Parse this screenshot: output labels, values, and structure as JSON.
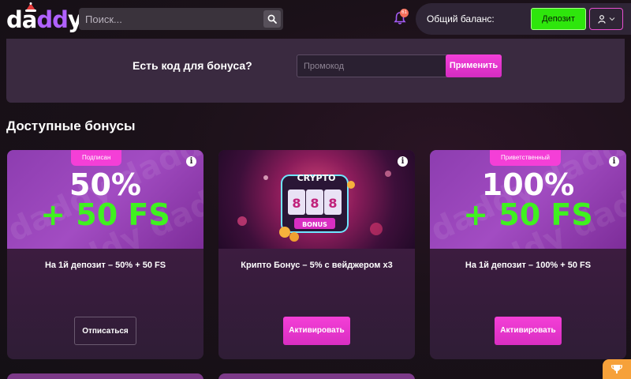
{
  "header": {
    "logo": "daddy",
    "search": {
      "placeholder": "Поиск..."
    },
    "notifications_count": "61",
    "balance_label": "Общий баланс:",
    "deposit_label": "Депозит"
  },
  "bonus_code": {
    "label": "Есть код для бонуса?",
    "placeholder": "Промокод",
    "apply_label": "Применить"
  },
  "section_title": "Доступные бонусы",
  "cards": [
    {
      "ribbon": "Подписан",
      "line1": "50%",
      "line2": "+ 50 FS",
      "title": "На 1й депозит – 50% + 50 FS",
      "button": "Отписаться"
    },
    {
      "ribbon": "",
      "image_text_1": "CRYPTO",
      "image_text_2": "BONUS",
      "title": "Крипто Бонус – 5% с вейджером x3",
      "button": "Активировать"
    },
    {
      "ribbon": "Приветственный",
      "line1": "100%",
      "line2": "+ 50 FS",
      "title": "На 1й депозит – 100% + 50 FS",
      "button": "Активировать"
    }
  ],
  "icons": {
    "search": "search-icon",
    "bell": "bell-icon",
    "user": "user-icon",
    "info": "info-icon",
    "trophy": "trophy-icon"
  },
  "colors": {
    "accent_pink": "#f43fd7",
    "deposit_green": "#2ee60c",
    "fs_green": "#3ff21f"
  }
}
